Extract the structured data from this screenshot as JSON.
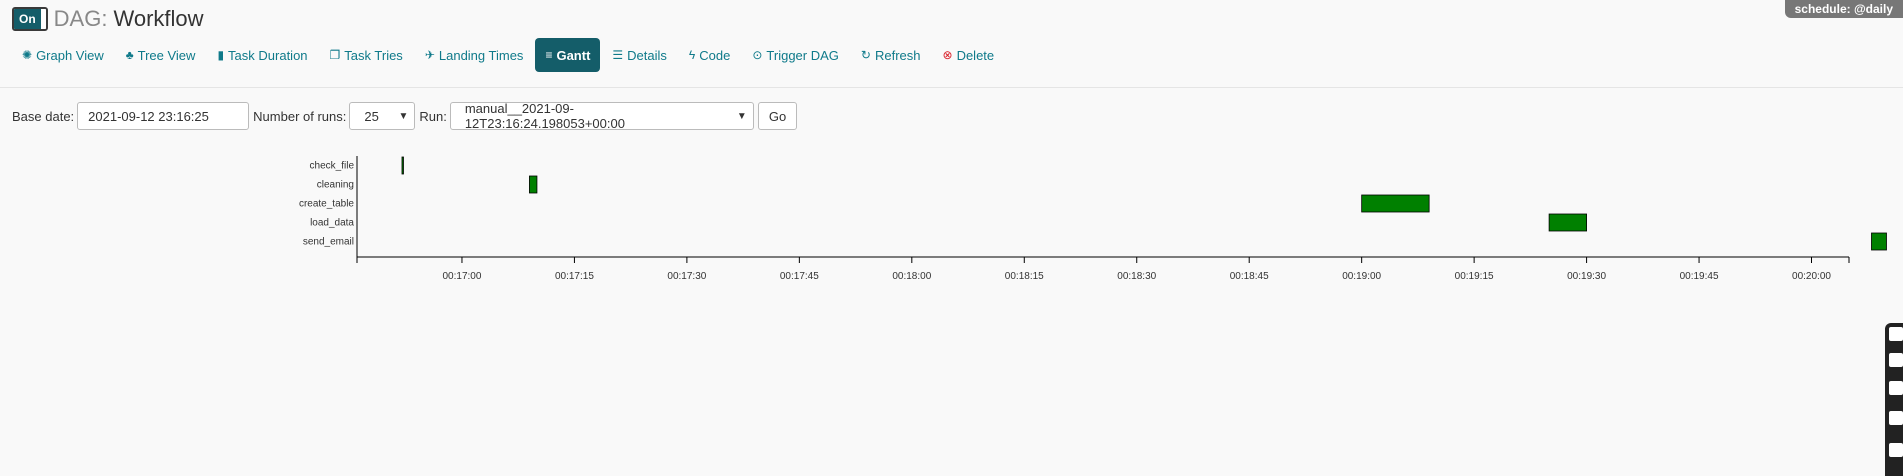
{
  "header": {
    "toggle_label": "On",
    "dag_prefix": "DAG:",
    "dag_id": "Workflow",
    "schedule": "schedule: @daily"
  },
  "nav": [
    {
      "label": "Graph View",
      "icon": "graph-icon",
      "glyph": "✺",
      "active": false
    },
    {
      "label": "Tree View",
      "icon": "tree-icon",
      "glyph": "♣",
      "active": false
    },
    {
      "label": "Task Duration",
      "icon": "bar-chart-icon",
      "glyph": "▮",
      "active": false
    },
    {
      "label": "Task Tries",
      "icon": "files-icon",
      "glyph": "❐",
      "active": false
    },
    {
      "label": "Landing Times",
      "icon": "plane-icon",
      "glyph": "✈",
      "active": false
    },
    {
      "label": "Gantt",
      "icon": "gantt-icon",
      "glyph": "≡",
      "active": true
    },
    {
      "label": "Details",
      "icon": "list-icon",
      "glyph": "☰",
      "active": false
    },
    {
      "label": "Code",
      "icon": "bolt-icon",
      "glyph": "ϟ",
      "active": false
    },
    {
      "label": "Trigger DAG",
      "icon": "play-circle-icon",
      "glyph": "⊙",
      "active": false
    },
    {
      "label": "Refresh",
      "icon": "refresh-icon",
      "glyph": "↻",
      "active": false
    },
    {
      "label": "Delete",
      "icon": "delete-circle-icon",
      "glyph": "⊗",
      "active": false
    }
  ],
  "form": {
    "base_date_label": "Base date:",
    "base_date_value": "2021-09-12 23:16:25",
    "num_runs_label": "Number of runs:",
    "num_runs_value": "25",
    "run_label": "Run:",
    "run_value": "manual__2021-09-12T23:16:24.198053+00:00",
    "go_label": "Go"
  },
  "colors": {
    "accent": "#145d69",
    "link": "#0f7a8a",
    "bar_success": "#008000",
    "delete": "#d9202a"
  },
  "chart_data": {
    "type": "gantt",
    "xlabel": "",
    "ylabel": "",
    "x_range_seconds": [
      -6,
      193
    ],
    "x_origin": "00:16:52",
    "ticks": [
      "00:17:00",
      "00:17:15",
      "00:17:30",
      "00:17:45",
      "00:18:00",
      "00:18:15",
      "00:18:30",
      "00:18:45",
      "00:19:00",
      "00:19:15",
      "00:19:30",
      "00:19:45",
      "00:20:00"
    ],
    "tasks": [
      {
        "name": "check_file",
        "start": "00:16:52",
        "end": "00:16:52"
      },
      {
        "name": "cleaning",
        "start": "00:17:09",
        "end": "00:17:10"
      },
      {
        "name": "create_table",
        "start": "00:19:00",
        "end": "00:19:09"
      },
      {
        "name": "load_data",
        "start": "00:19:25",
        "end": "00:19:30"
      },
      {
        "name": "send_email",
        "start": "00:20:08",
        "end": "00:20:10"
      }
    ]
  }
}
